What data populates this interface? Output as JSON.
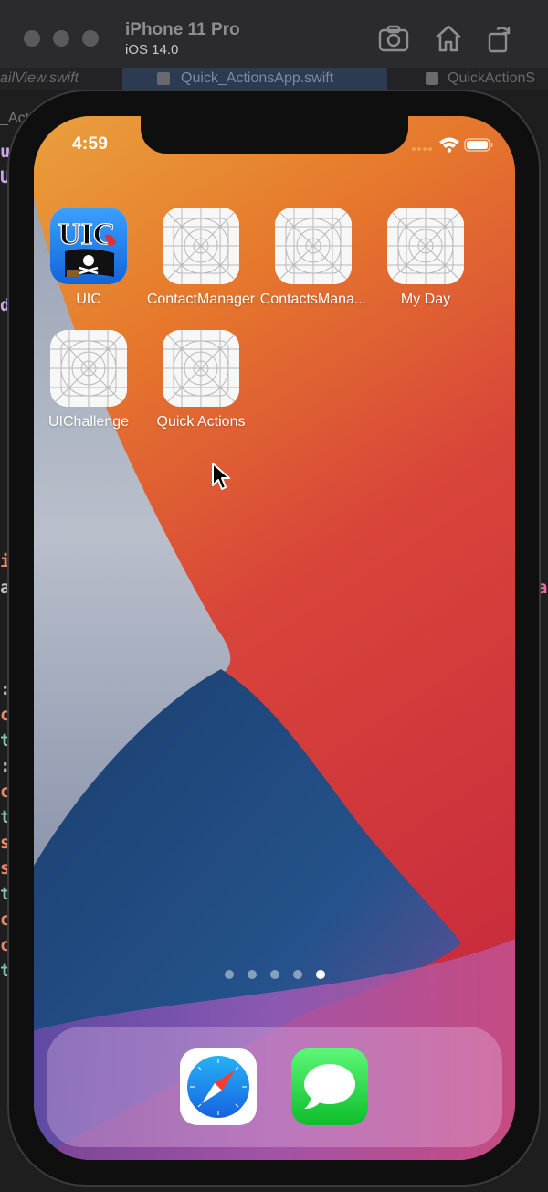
{
  "simulator": {
    "device_name": "iPhone 11 Pro",
    "os_version": "iOS 14.0",
    "toolbar_icons": [
      "screenshot-icon",
      "home-icon",
      "rotate-icon"
    ]
  },
  "editor_tabs": [
    {
      "label": "ailView.swift"
    },
    {
      "label": "Quick_ActionsApp.swift"
    },
    {
      "label": "QuickActionS"
    }
  ],
  "editor_sidebar_label": "_Acti",
  "status_bar": {
    "time": "4:59"
  },
  "home_screen": {
    "apps": [
      {
        "label": "UIC",
        "icon": "uic-pirate-icon"
      },
      {
        "label": "ContactManager",
        "icon": "placeholder-grid-icon"
      },
      {
        "label": "ContactsMana...",
        "icon": "placeholder-grid-icon"
      },
      {
        "label": "My Day",
        "icon": "placeholder-grid-icon"
      },
      {
        "label": "UIChallenge",
        "icon": "placeholder-grid-icon"
      },
      {
        "label": "Quick Actions",
        "icon": "placeholder-grid-icon"
      }
    ],
    "uic_icon_text": "UIC",
    "page_count": 5,
    "active_page": 5
  },
  "dock": {
    "apps": [
      {
        "name": "Safari",
        "icon": "safari-icon"
      },
      {
        "name": "Messages",
        "icon": "messages-icon"
      }
    ]
  },
  "colors": {
    "wallpaper_orange": "#e07a2c",
    "wallpaper_red": "#d4333a",
    "wallpaper_blue": "#1f4f86",
    "wallpaper_gray": "#a9b1c2",
    "messages_green": "#33c759",
    "safari_blue": "#1a8cf0"
  }
}
